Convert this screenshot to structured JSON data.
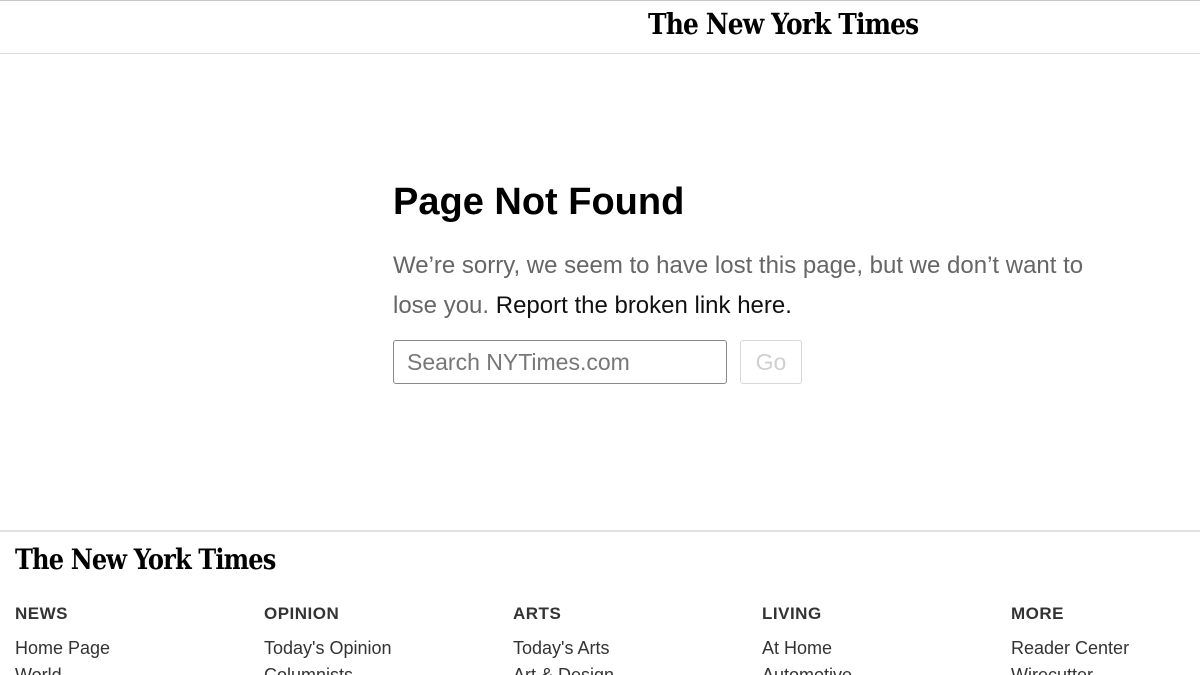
{
  "header": {
    "masthead": "The New York Times"
  },
  "main": {
    "title": "Page Not Found",
    "message": "We’re sorry, we seem to have lost this page, but we don’t want to lose you.",
    "report_link": "Report the broken link here.",
    "search": {
      "placeholder": "Search NYTimes.com",
      "value": ""
    },
    "go_label": "Go"
  },
  "footer": {
    "logo": "The New York Times",
    "columns": [
      {
        "heading": "NEWS",
        "items": [
          "Home Page",
          "World"
        ]
      },
      {
        "heading": "OPINION",
        "items": [
          "Today's Opinion",
          "Columnists"
        ]
      },
      {
        "heading": "ARTS",
        "items": [
          "Today's Arts",
          "Art & Design"
        ]
      },
      {
        "heading": "LIVING",
        "items": [
          "At Home",
          "Automotive"
        ]
      },
      {
        "heading": "MORE",
        "items": [
          "Reader Center",
          "Wirecutter"
        ]
      }
    ]
  }
}
